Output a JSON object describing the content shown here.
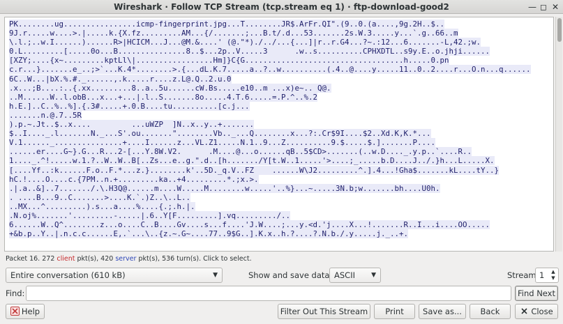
{
  "window": {
    "title": "Wireshark · Follow TCP Stream (tcp.stream eq 1) · ftp-download-good2"
  },
  "stream_lines": [
    "PK........ug................icmp-fingerprint.jpg...T........JR$.ArFr.QI\".(9..0.(a....,9g.2H..$..",
    "9J.r.....w....>.|.....k.{X.fz.........AM...{/.......;...B.t/.d...53.......2s.W.3.....y...`.g..66..m",
    "\\.l.;..w.I......)......R>|HCICM...J...@M.&....' (@.\"*)./../...{...]|r..r.G4...?~.:12...6.......-L,42.;w.",
    "0.L.........[.....0o...B...............8..$...2p..V.....3      .w..s..........CPHXDTL..s9y.E..o.jhji......",
    "[XZY;....{x~.........kptLl\\|.................Hm]}C{G...................................h.....0.pn",
    "c.r...}.......e_..;>`...K.4*........>.{...dL.K.7.....a..?..w..........(.4..@....y.....11..0..2....r...O.n...q......",
    "6C..W...|bX.%.#._......,.k.....r....z.L@.Q..2.u.0",
    ".x...;B....:..{.xx.........8..a..5u......cW.Bs.....e10..m ...x)e~.. Q@.",
    "..M......W..l.obB...x...+...|.l..S.......8o.....4.T.6.....=.P.^..%.2",
    "h.E.]..C..%..%].{.3#.....+.0.B....tu..........[c.j...",
    ".......n.@.7..5R",
    ").p.~.Jt..$..x....         ...uWZP  ]N..x..y..+.......",
    "$..I...._.l.......N._...S'.ou.......\"........Vb.._...Q........x...?:.Cr$9I....$2..Xd.K,K.*...",
    "V.1......_...............+....I......z...VL.Z1.....N.1..9...Z..........9.$.....$.].......P....",
    "......er....G~}.G...R...2-[...Y.8W.V2.      .M....@...o......qB..5$CD>.......(..w.D...._.y.p..`....R..",
    "1...._.^!.....w.1.?..W..W..B[..Zs...e..g.\".d..[h......./Y[t.W..1.....'>....;_.....b.D....J../.}h...L.....X.",
    "[....Yf..:k......F.o..F.*...z.}........k'..5D._q.V..FZ    ......W\\J2.........^.].4...!Gha$.......kL....tY..}",
    "hC.!....O....c.{7PM..n.+.........ka..+4.........*.;x.>.",
    ".|.a..&]..7......./.\\.H3Q@......m....W.....M........w.....'..%}...~.....3N.b;w.......bh....U0h.",
    ". ....B...9..C.......>....K.`.)Z..\\..L..",
    "..MX...^.........).s...a....%....{.;.h.|.",
    ".N.oj%.......'.........-.....|.6..Y[F.........].vq........./..",
    "6......W..Q^........z...o....C..B....Gv....s...f....'J.W....;...y.<d.'j....X...!.......R..I...i....OO.....",
    "+&b.p..Y..|.n.c.c......E,.`...\\..{z.~.G~....77..9$G..].K.x..h.?....?.N.b./.y.....j._..+."
  ],
  "status": {
    "prefix": "Packet 16. 272 ",
    "client": "client",
    "middle1": " pkt(s), 420 ",
    "server": "server",
    "suffix": " pkt(s), 536 turn(s). Click to select."
  },
  "controls": {
    "conversation_select": "Entire conversation (610 kB)",
    "show_save_label": "Show and save data as",
    "format_select": "ASCII",
    "stream_label": "Stream",
    "stream_value": "1",
    "find_label": "Find:",
    "find_value": ""
  },
  "buttons": {
    "find_next": "Find Next",
    "help": "Help",
    "filter_out": "Filter Out This Stream",
    "print": "Print",
    "save_as": "Save as...",
    "back": "Back",
    "close": "Close"
  },
  "colors": {
    "client": "#c6282b",
    "server": "#2e47b8",
    "stream_bg": "#e9eaf8"
  }
}
